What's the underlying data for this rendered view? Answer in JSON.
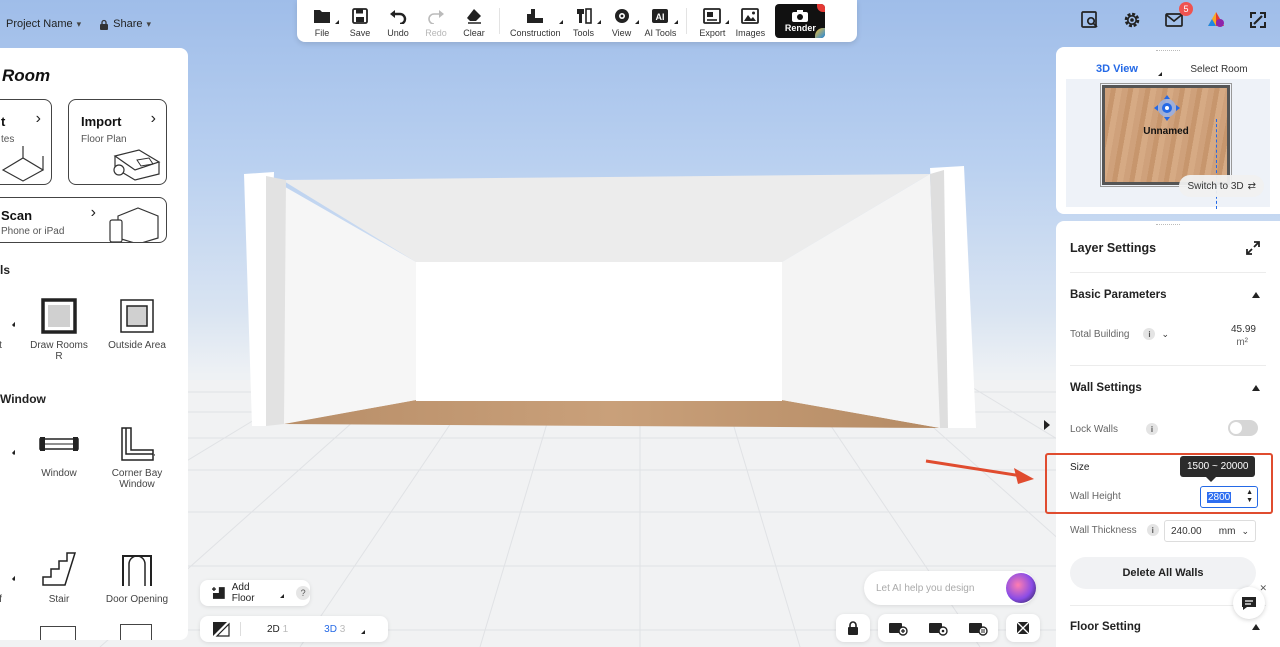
{
  "project": {
    "name": "Project Name",
    "share": "Share"
  },
  "toolbar": {
    "file": "File",
    "save": "Save",
    "undo": "Undo",
    "redo": "Redo",
    "clear": "Clear",
    "construction": "Construction",
    "tools": "Tools",
    "view": "View",
    "ai_tools": "AI Tools",
    "export": "Export",
    "images": "Images",
    "render": "Render"
  },
  "top_right": {
    "mail_badge": "5"
  },
  "left_panel": {
    "title": "Room",
    "card_create": {
      "title": "t",
      "sub": "tes"
    },
    "card_import": {
      "title": "Import",
      "sub": "Floor Plan"
    },
    "card_scan": {
      "title": "Scan",
      "sub": "Phone or iPad"
    },
    "section_walls": "ls",
    "tools_walls": [
      {
        "label": "ght",
        "sub": ""
      },
      {
        "label": "Draw Rooms",
        "sub": "R"
      },
      {
        "label": "Outside Area",
        "sub": ""
      }
    ],
    "section_window": "Window",
    "tools_window": [
      {
        "label": "or",
        "sub": ""
      },
      {
        "label": "Window",
        "sub": ""
      },
      {
        "label": "Corner Bay",
        "sub": "Window"
      }
    ],
    "tools_misc": [
      {
        "label": "oof"
      },
      {
        "label": "Stair"
      },
      {
        "label": "Door Opening"
      }
    ]
  },
  "bottom_left": {
    "add_floor": "Add Floor",
    "help": "?",
    "view_2d": "2D",
    "view_2d_num": "1",
    "view_3d": "3D",
    "view_3d_num": "3"
  },
  "minimap": {
    "tab_3d": "3D View",
    "tab_select": "Select Room",
    "room_label": "Unnamed",
    "switch_label": "Switch to 3D"
  },
  "settings": {
    "title": "Layer Settings",
    "basic_params": "Basic Parameters",
    "total_building": "Total Building",
    "total_value": "45.99",
    "total_unit": "m²",
    "wall_settings": "Wall Settings",
    "lock_walls": "Lock Walls",
    "size": "Size",
    "tooltip_range": "1500 ~ 20000",
    "wall_height_label": "Wall Height",
    "wall_height_value": "2800",
    "wall_thickness_label": "Wall Thickness",
    "wall_thickness_value": "240.00",
    "wall_thickness_unit": "mm",
    "delete_walls": "Delete All Walls",
    "floor_setting": "Floor Setting"
  },
  "ai": {
    "placeholder": "Let AI help you design"
  },
  "colors": {
    "accent": "#2469e6",
    "highlight": "#e04c2f",
    "badge": "#ef5350"
  }
}
